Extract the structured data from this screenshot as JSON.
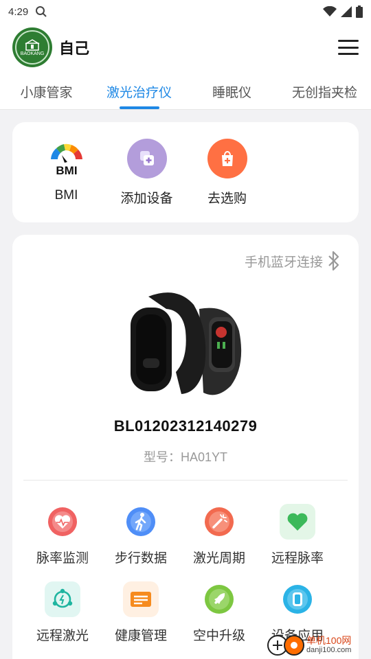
{
  "status_bar": {
    "time": "4:29"
  },
  "header": {
    "user_name": "自己",
    "avatar_text": "BAOKANG"
  },
  "tabs": [
    {
      "label": "小康管家",
      "active": false
    },
    {
      "label": "激光治疗仪",
      "active": true
    },
    {
      "label": "睡眠仪",
      "active": false
    },
    {
      "label": "无创指夹检",
      "active": false
    }
  ],
  "quick_actions": [
    {
      "label": "BMI",
      "icon": "bmi-gauge-icon"
    },
    {
      "label": "添加设备",
      "icon": "add-device-icon"
    },
    {
      "label": "去选购",
      "icon": "shopping-bag-icon"
    }
  ],
  "device": {
    "bluetooth_label": "手机蓝牙连接",
    "serial": "BL01202312140279",
    "model": "型号：HA01YT"
  },
  "functions": [
    {
      "label": "脉率监测",
      "icon": "heart-monitor-icon",
      "color": "#f06262"
    },
    {
      "label": "步行数据",
      "icon": "walking-icon",
      "color": "#4f8ef7"
    },
    {
      "label": "激光周期",
      "icon": "laser-wand-icon",
      "color": "#f26a4f"
    },
    {
      "label": "远程脉率",
      "icon": "green-heart-icon",
      "color": "#3cb95a"
    },
    {
      "label": "远程激光",
      "icon": "remote-laser-icon",
      "color": "#1fb5a0"
    },
    {
      "label": "健康管理",
      "icon": "health-card-icon",
      "color": "#f68b1e"
    },
    {
      "label": "空中升级",
      "icon": "rocket-icon",
      "color": "#7dc741"
    },
    {
      "label": "设备应用",
      "icon": "watch-icon",
      "color": "#2bb3e6"
    }
  ],
  "watermark": {
    "title": "单机100网",
    "url": "danji100.com"
  }
}
